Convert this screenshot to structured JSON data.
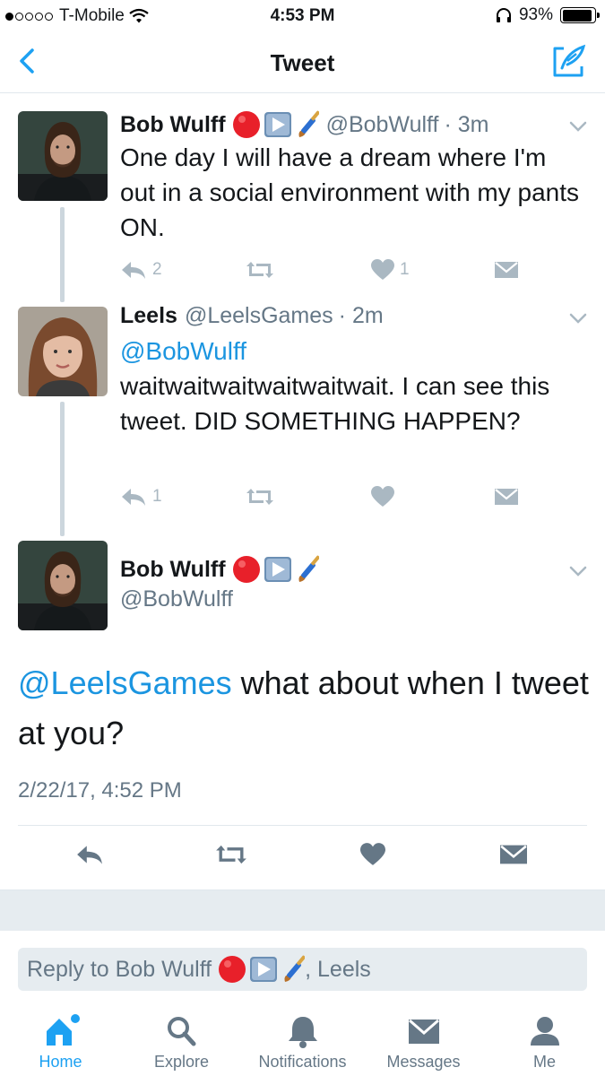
{
  "status_bar": {
    "carrier": "T-Mobile",
    "time": "4:53 PM",
    "battery": "93%",
    "battery_level": 0.93
  },
  "nav": {
    "title": "Tweet"
  },
  "tweets": [
    {
      "name": "Bob Wulff",
      "handle": "@BobWulff",
      "time": "· 3m",
      "text": "One day I will have a dream where I'm out in a social environment with my pants ON.",
      "reply_count": "2",
      "like_count": "1"
    },
    {
      "name": "Leels",
      "handle": "@LeelsGames",
      "time": "· 2m",
      "mention": "@BobWulff",
      "text": "waitwaitwaitwaitwaitwait. I can see this tweet. DID SOMETHING HAPPEN?",
      "reply_count": "1"
    }
  ],
  "main_tweet": {
    "name": "Bob Wulff",
    "handle": "@BobWulff",
    "mention": "@LeelsGames",
    "text": " what about when I tweet at you?",
    "timestamp": "2/22/17, 4:52 PM"
  },
  "reply_box": {
    "prefix": "Reply to Bob Wulff",
    "suffix": ", Leels"
  },
  "tabs": [
    {
      "label": "Home"
    },
    {
      "label": "Explore"
    },
    {
      "label": "Notifications"
    },
    {
      "label": "Messages"
    },
    {
      "label": "Me"
    }
  ],
  "colors": {
    "accent": "#1da1f2",
    "mention": "#1b95e0",
    "muted": "#657786",
    "action_gray": "#aab8c2"
  }
}
